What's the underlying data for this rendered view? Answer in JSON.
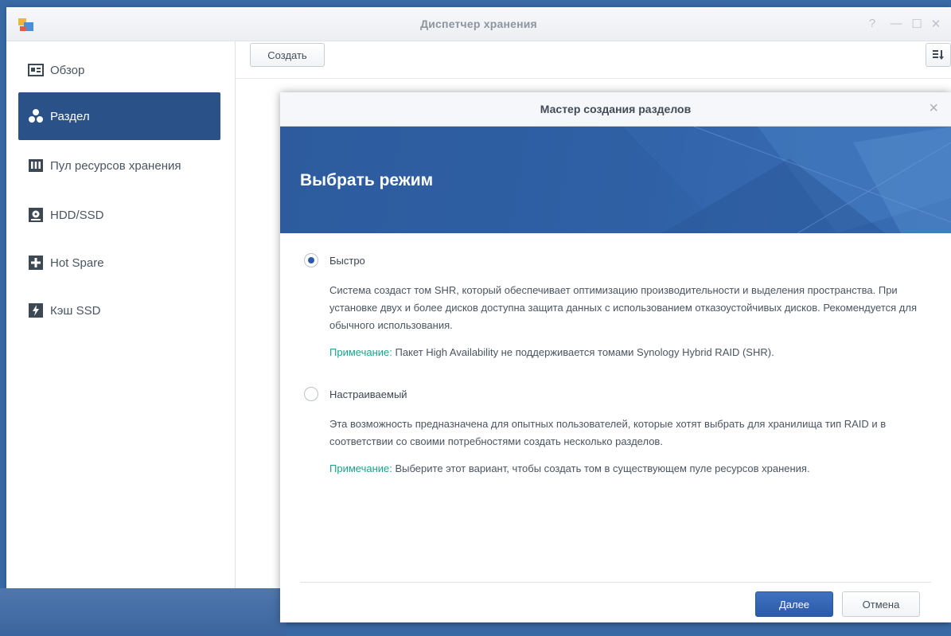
{
  "window": {
    "title": "Диспетчер хранения",
    "controls": [
      "?",
      "—",
      "☐",
      "✕"
    ]
  },
  "sidebar": {
    "items": [
      {
        "label": "Обзор",
        "icon": "overview-icon"
      },
      {
        "label": "Раздел",
        "icon": "volume-icon",
        "active": true
      },
      {
        "label": "Пул ресурсов хранения",
        "icon": "storage-pool-icon"
      },
      {
        "label": "HDD/SSD",
        "icon": "hdd-icon"
      },
      {
        "label": "Hot Spare",
        "icon": "hot-spare-icon"
      },
      {
        "label": "Кэш SSD",
        "icon": "ssd-cache-icon"
      }
    ]
  },
  "toolbar": {
    "create_label": "Создать",
    "sort_icon": "sort-icon"
  },
  "wizard": {
    "title": "Мастер создания разделов",
    "heading": "Выбрать режим",
    "options": [
      {
        "label": "Быстро",
        "selected": true,
        "description": "Система создаст том SHR, который обеспечивает оптимизацию производительности и выделения пространства. При установке двух и более дисков доступна защита данных с использованием отказоустойчивых дисков. Рекомендуется для обычного использования.",
        "note_label": "Примечание:",
        "note_text": "Пакет High Availability не поддерживается томами Synology Hybrid RAID (SHR)."
      },
      {
        "label": "Настраиваемый",
        "selected": false,
        "description": "Эта возможность предназначена для опытных пользователей, которые хотят выбрать для хранилища тип RAID и в соответствии со своими потребностями создать несколько разделов.",
        "note_label": "Примечание:",
        "note_text": "Выберите этот вариант, чтобы создать том в существующем пуле ресурсов хранения."
      }
    ],
    "next_label": "Далее",
    "cancel_label": "Отмена"
  },
  "colors": {
    "accent": "#2a5188",
    "banner": "#2f60a5",
    "note_label": "#1aa38a"
  }
}
